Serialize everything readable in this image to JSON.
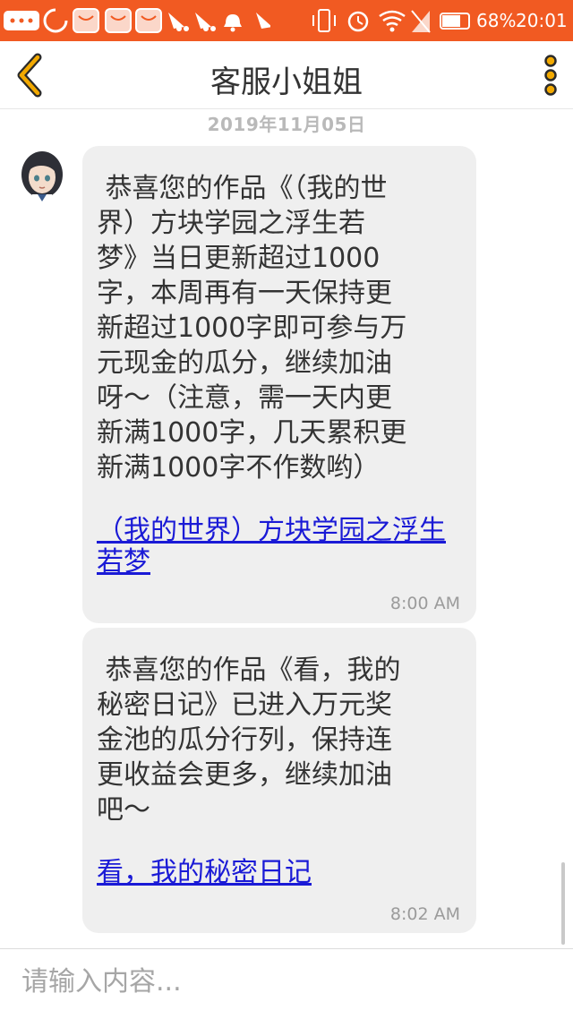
{
  "status_bar": {
    "battery": "68%",
    "time": "20:01",
    "color": "#f15a22"
  },
  "header": {
    "title": "客服小姐姐",
    "back_icon": "chevron-left-icon",
    "more_icon": "more-vertical-icon",
    "accent": "#f2a900"
  },
  "chat": {
    "date": "2019年11月05日",
    "messages": [
      {
        "text": " 恭喜您的作品《（我的世\n界）方块学园之浮生若\n梦》当日更新超过1000\n字，本周再有一天保持更\n新超过1000字即可参与万\n元现金的瓜分，继续加油\n呀～（注意，需一天内更\n新满1000字，几天累积更\n新满1000字不作数哟）",
        "link": "（我的世界）方块学园之浮生若梦",
        "time": "8:00 AM"
      },
      {
        "text": " 恭喜您的作品《看，我的\n秘密日记》已进入万元奖\n金池的瓜分行列，保持连\n更收益会更多，继续加油\n吧～",
        "link": "看，我的秘密日记",
        "time": "8:02 AM"
      }
    ]
  },
  "input": {
    "placeholder": "请输入内容..."
  }
}
